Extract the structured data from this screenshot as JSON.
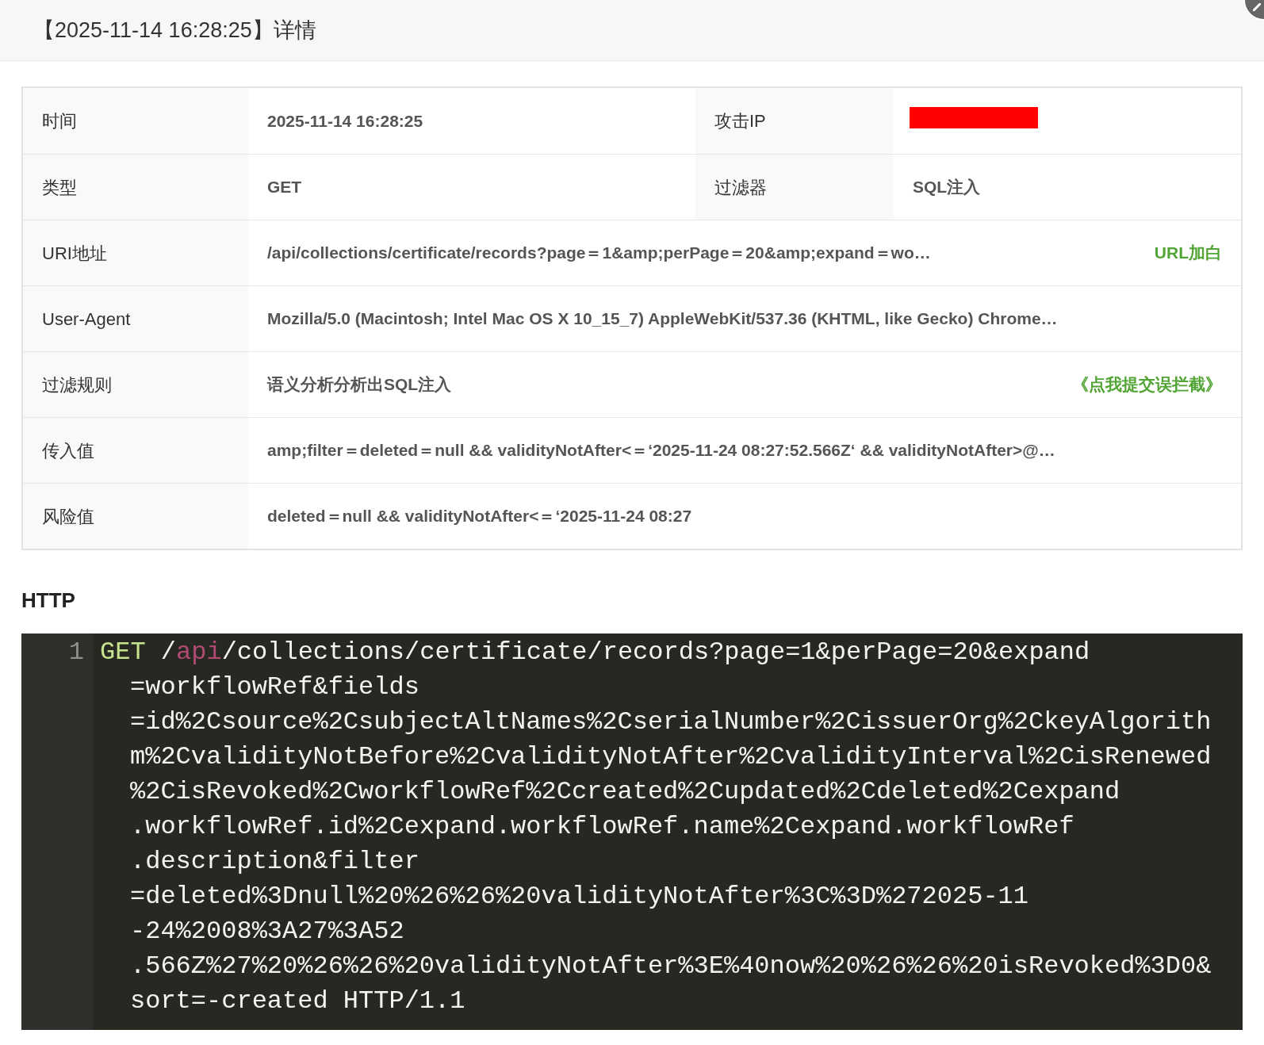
{
  "header": {
    "title": "【2025-11-14 16:28:25】详情"
  },
  "details": [
    {
      "cells": [
        {
          "kind": "label",
          "text": "时间"
        },
        {
          "kind": "value",
          "text": "2025-11-14 16:28:25"
        },
        {
          "kind": "label",
          "text": "攻击IP"
        },
        {
          "kind": "redacted"
        }
      ]
    },
    {
      "cells": [
        {
          "kind": "label",
          "text": "类型"
        },
        {
          "kind": "value",
          "text": "GET"
        },
        {
          "kind": "label",
          "text": "过滤器"
        },
        {
          "kind": "value",
          "text": "SQL注入"
        }
      ]
    },
    {
      "cells": [
        {
          "kind": "label",
          "text": "URI地址"
        },
        {
          "kind": "value",
          "text": "/api/collections/certificate/records?page＝1&amp;perPage＝20&amp;expand＝wo…",
          "action": "URL加白"
        }
      ]
    },
    {
      "cells": [
        {
          "kind": "label",
          "text": "User-Agent"
        },
        {
          "kind": "value",
          "text": "Mozilla/5.0 (Macintosh; Intel Mac OS X 10_15_7) AppleWebKit/537.36 (KHTML, like Gecko) Chrome…"
        }
      ]
    },
    {
      "cells": [
        {
          "kind": "label",
          "text": "过滤规则"
        },
        {
          "kind": "value",
          "text": "语义分析分析出SQL注入",
          "action": "《点我提交误拦截》"
        }
      ]
    },
    {
      "cells": [
        {
          "kind": "label",
          "text": "传入值"
        },
        {
          "kind": "value",
          "text": "amp;filter＝deleted＝null && validityNotAfter<＝‘2025-11-24 08:27:52.566Z‘ && validityNotAfter>@…"
        }
      ]
    },
    {
      "cells": [
        {
          "kind": "label",
          "text": "风险值"
        },
        {
          "kind": "value",
          "text": "deleted＝null && validityNotAfter<＝‘2025-11-24 08:27"
        }
      ]
    }
  ],
  "http": {
    "heading": "HTTP",
    "lines": [
      {
        "number": "1",
        "first_row": [
          {
            "kind": "method",
            "text": "GET"
          },
          {
            "kind": "plain",
            "text": " /"
          },
          {
            "kind": "keyword",
            "text": "api"
          },
          {
            "kind": "plain",
            "text": "/collections/certificate/records?page=1&perPage=20&expand"
          }
        ],
        "continuation_rows": [
          "=workflowRef&fields",
          "=id%2Csource%2CsubjectAltNames%2CserialNumber%2CissuerOrg%2CkeyAlgorith",
          "m%2CvalidityNotBefore%2CvalidityNotAfter%2CvalidityInterval%2CisRenewed",
          "%2CisRevoked%2CworkflowRef%2Ccreated%2Cupdated%2Cdeleted%2Cexpand",
          ".workflowRef.id%2Cexpand.workflowRef.name%2Cexpand.workflowRef",
          ".description&filter",
          "=deleted%3Dnull%20%26%26%20validityNotAfter%3C%3D%272025-11",
          "-24%2008%3A27%3A52",
          ".566Z%27%20%26%26%20validityNotAfter%3E%40now%20%26%26%20isRevoked%3D0&",
          "sort=-created HTTP/1.1"
        ]
      }
    ]
  }
}
